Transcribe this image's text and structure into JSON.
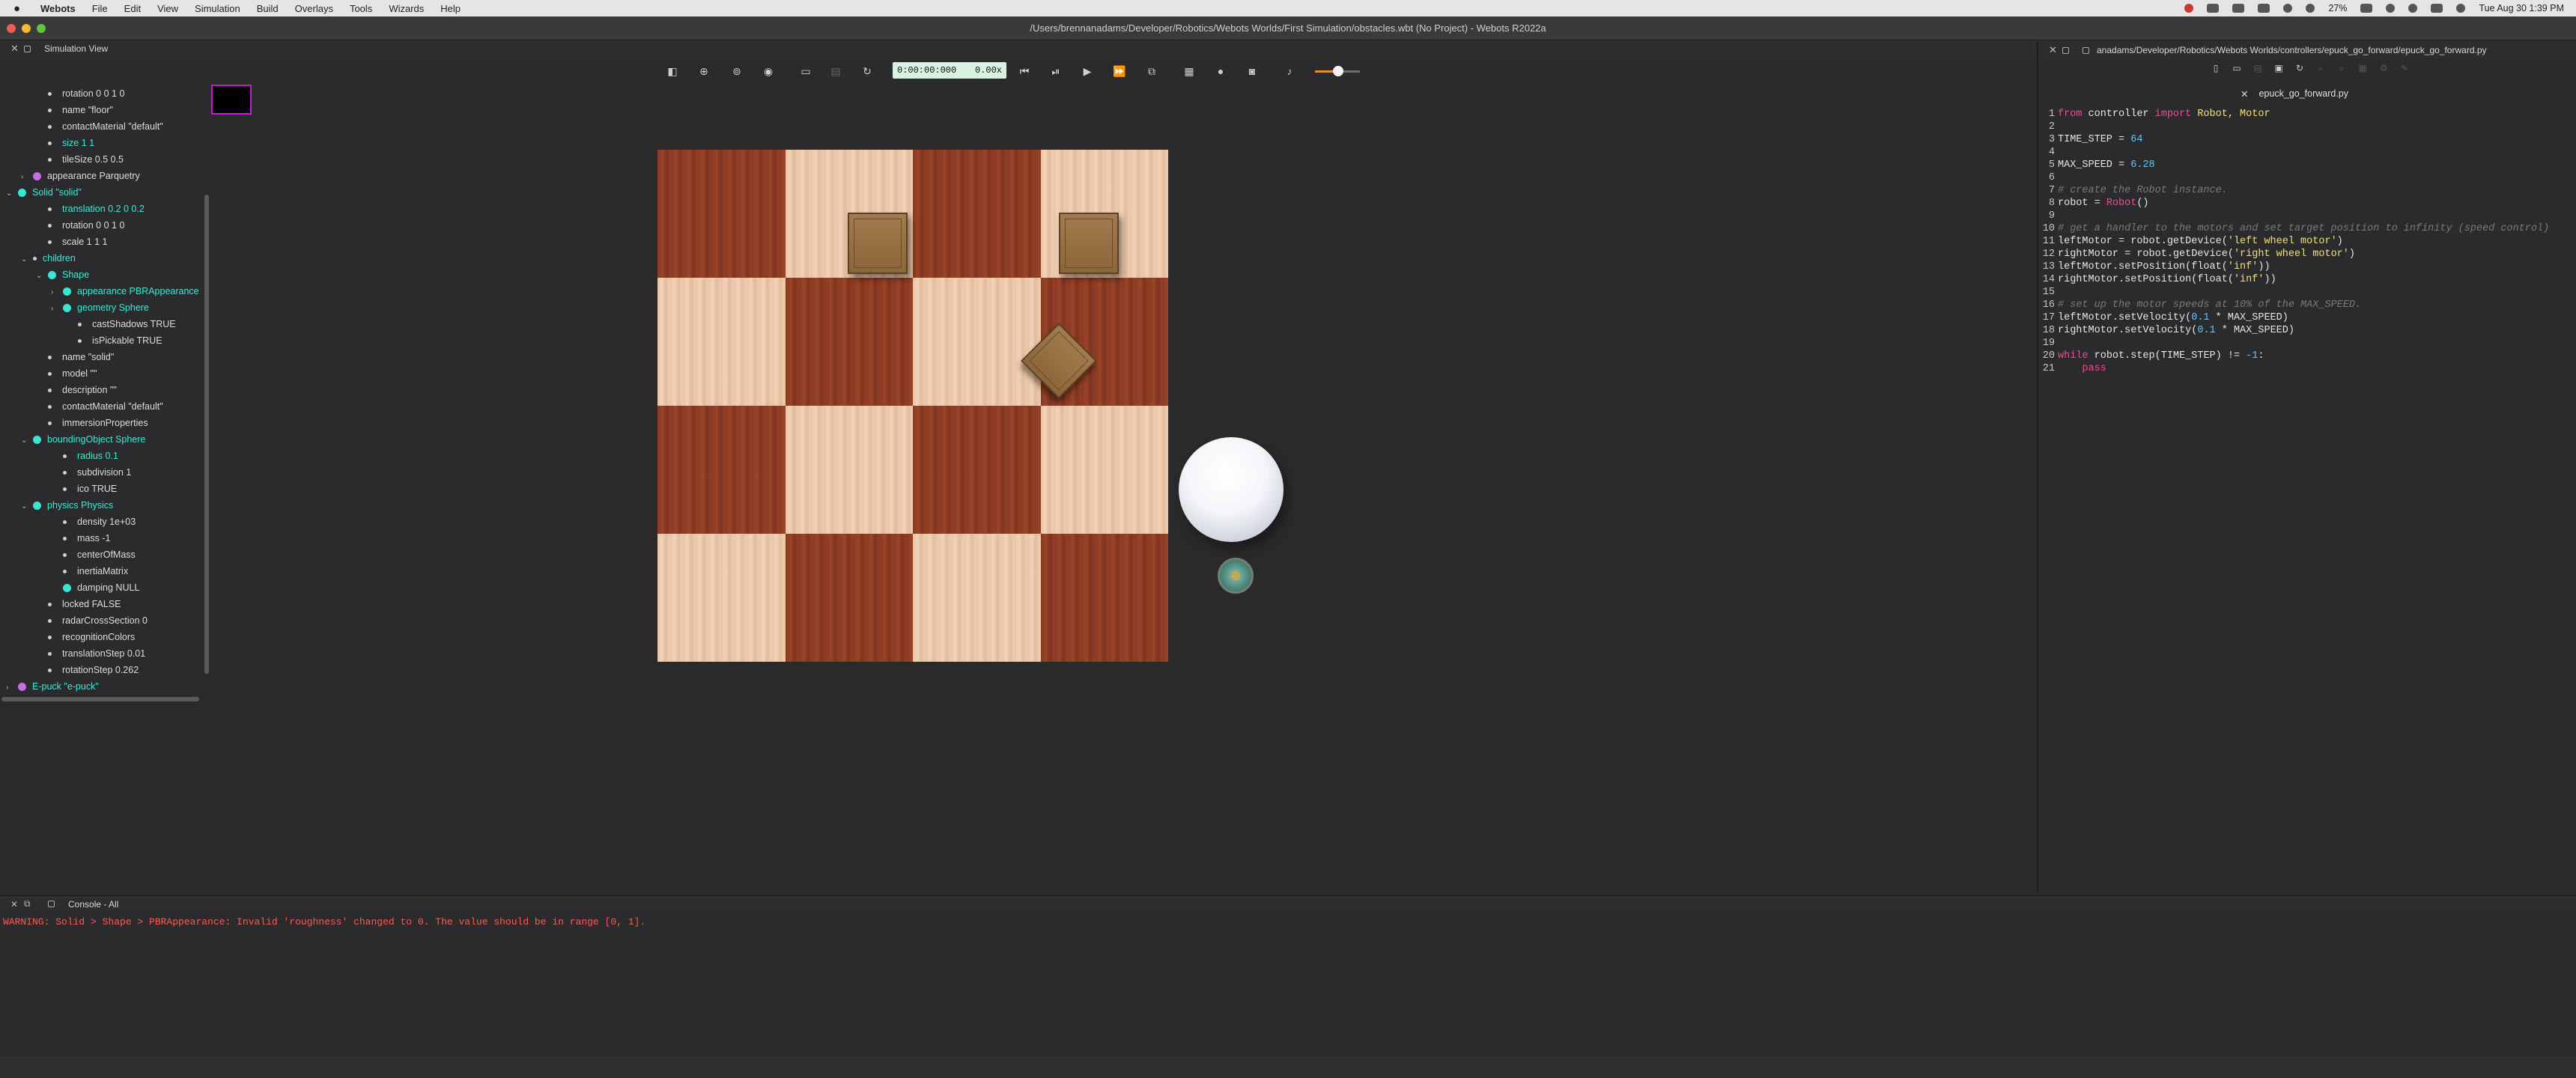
{
  "menubar": {
    "app": "Webots",
    "items": [
      "File",
      "Edit",
      "View",
      "Simulation",
      "Build",
      "Overlays",
      "Tools",
      "Wizards",
      "Help"
    ],
    "battery": "27%",
    "datetime": "Tue Aug 30  1:39 PM"
  },
  "window": {
    "title": "/Users/brennanadams/Developer/Robotics/Webots Worlds/First Simulation/obstacles.wbt (No Project) - Webots R2022a"
  },
  "simulation_view": {
    "title": "Simulation View",
    "time": "0:00:00:000",
    "speed": "0.00x",
    "sound_volume": 0.5
  },
  "scene_tree": [
    {
      "label": "rotation 0 0 1 0",
      "kind": "field",
      "indent": 3
    },
    {
      "label": "name \"floor\"",
      "kind": "field",
      "indent": 3
    },
    {
      "label": "contactMaterial \"default\"",
      "kind": "field",
      "indent": 3
    },
    {
      "label": "size 1 1",
      "kind": "field",
      "indent": 3,
      "highlight": true
    },
    {
      "label": "tileSize 0.5 0.5",
      "kind": "field",
      "indent": 3
    },
    {
      "label": "appearance Parquetry",
      "kind": "node",
      "indent": 2,
      "color": "purple",
      "arrow": "›"
    },
    {
      "label": "Solid \"solid\"",
      "kind": "node",
      "indent": 1,
      "color": "cyan",
      "arrow": "⌄",
      "highlight": true
    },
    {
      "label": "translation 0.2 0 0.2",
      "kind": "field",
      "indent": 3,
      "highlight": true
    },
    {
      "label": "rotation 0 0 1 0",
      "kind": "field",
      "indent": 3
    },
    {
      "label": "scale 1 1 1",
      "kind": "field",
      "indent": 3
    },
    {
      "label": "children",
      "kind": "group",
      "indent": 2,
      "arrow": "⌄",
      "highlight": true
    },
    {
      "label": "Shape",
      "kind": "node",
      "indent": 3,
      "color": "cyan",
      "arrow": "⌄",
      "highlight": true
    },
    {
      "label": "appearance PBRAppearance",
      "kind": "node",
      "indent": 4,
      "color": "cyan",
      "arrow": "›",
      "highlight": true
    },
    {
      "label": "geometry Sphere",
      "kind": "node",
      "indent": 4,
      "color": "cyan",
      "arrow": "›",
      "highlight": true
    },
    {
      "label": "castShadows TRUE",
      "kind": "field",
      "indent": 5
    },
    {
      "label": "isPickable TRUE",
      "kind": "field",
      "indent": 5
    },
    {
      "label": "name \"solid\"",
      "kind": "field",
      "indent": 3
    },
    {
      "label": "model \"\"",
      "kind": "field",
      "indent": 3
    },
    {
      "label": "description \"\"",
      "kind": "field",
      "indent": 3
    },
    {
      "label": "contactMaterial \"default\"",
      "kind": "field",
      "indent": 3
    },
    {
      "label": "immersionProperties",
      "kind": "field",
      "indent": 3
    },
    {
      "label": "boundingObject Sphere",
      "kind": "node",
      "indent": 2,
      "color": "cyan",
      "arrow": "⌄",
      "highlight": true
    },
    {
      "label": "radius 0.1",
      "kind": "field",
      "indent": 4,
      "highlight": true
    },
    {
      "label": "subdivision 1",
      "kind": "field",
      "indent": 4
    },
    {
      "label": "ico TRUE",
      "kind": "field",
      "indent": 4
    },
    {
      "label": "physics Physics",
      "kind": "node",
      "indent": 2,
      "color": "cyan",
      "arrow": "⌄",
      "highlight": true
    },
    {
      "label": "density 1e+03",
      "kind": "field",
      "indent": 4
    },
    {
      "label": "mass -1",
      "kind": "field",
      "indent": 4
    },
    {
      "label": "centerOfMass",
      "kind": "field",
      "indent": 4
    },
    {
      "label": "inertiaMatrix",
      "kind": "field",
      "indent": 4
    },
    {
      "label": "damping NULL",
      "kind": "node",
      "indent": 4,
      "color": "cyan"
    },
    {
      "label": "locked FALSE",
      "kind": "field",
      "indent": 3
    },
    {
      "label": "radarCrossSection 0",
      "kind": "field",
      "indent": 3
    },
    {
      "label": "recognitionColors",
      "kind": "field",
      "indent": 3
    },
    {
      "label": "translationStep 0.01",
      "kind": "field",
      "indent": 3
    },
    {
      "label": "rotationStep 0.262",
      "kind": "field",
      "indent": 3
    },
    {
      "label": "E-puck \"e-puck\"",
      "kind": "node",
      "indent": 1,
      "color": "purple",
      "arrow": "›",
      "highlight": true
    }
  ],
  "editor": {
    "path": "anadams/Developer/Robotics/Webots Worlds/controllers/epuck_go_forward/epuck_go_forward.py",
    "tab": "epuck_go_forward.py",
    "lines": [
      [
        {
          "t": "kw",
          "v": "from"
        },
        {
          "t": "txt",
          "v": " controller "
        },
        {
          "t": "kw",
          "v": "import"
        },
        {
          "t": "str",
          "v": " Robot, Motor"
        }
      ],
      [],
      [
        {
          "t": "txt",
          "v": "TIME_STEP = "
        },
        {
          "t": "num",
          "v": "64"
        }
      ],
      [],
      [
        {
          "t": "txt",
          "v": "MAX_SPEED = "
        },
        {
          "t": "num",
          "v": "6.28"
        }
      ],
      [],
      [
        {
          "t": "com",
          "v": "# create the Robot instance."
        }
      ],
      [
        {
          "t": "txt",
          "v": "robot = "
        },
        {
          "t": "kw",
          "v": "Robot"
        },
        {
          "t": "txt",
          "v": "()"
        }
      ],
      [],
      [
        {
          "t": "com",
          "v": "# get a handler to the motors and set target position to infinity (speed control)"
        }
      ],
      [
        {
          "t": "txt",
          "v": "leftMotor = robot.getDevice("
        },
        {
          "t": "str",
          "v": "'left wheel motor'"
        },
        {
          "t": "txt",
          "v": ")"
        }
      ],
      [
        {
          "t": "txt",
          "v": "rightMotor = robot.getDevice("
        },
        {
          "t": "str",
          "v": "'right wheel motor'"
        },
        {
          "t": "txt",
          "v": ")"
        }
      ],
      [
        {
          "t": "txt",
          "v": "leftMotor.setPosition(float("
        },
        {
          "t": "str",
          "v": "'inf'"
        },
        {
          "t": "txt",
          "v": "))"
        }
      ],
      [
        {
          "t": "txt",
          "v": "rightMotor.setPosition(float("
        },
        {
          "t": "str",
          "v": "'inf'"
        },
        {
          "t": "txt",
          "v": "))"
        }
      ],
      [],
      [
        {
          "t": "com",
          "v": "# set up the motor speeds at 10% of the MAX_SPEED."
        }
      ],
      [
        {
          "t": "txt",
          "v": "leftMotor.setVelocity("
        },
        {
          "t": "num",
          "v": "0.1"
        },
        {
          "t": "txt",
          "v": " * MAX_SPEED)"
        }
      ],
      [
        {
          "t": "txt",
          "v": "rightMotor.setVelocity("
        },
        {
          "t": "num",
          "v": "0.1"
        },
        {
          "t": "txt",
          "v": " * MAX_SPEED)"
        }
      ],
      [],
      [
        {
          "t": "kw",
          "v": "while"
        },
        {
          "t": "txt",
          "v": " robot.step(TIME_STEP) != "
        },
        {
          "t": "num",
          "v": "-1"
        },
        {
          "t": "txt",
          "v": ":"
        }
      ],
      [
        {
          "t": "txt",
          "v": "    "
        },
        {
          "t": "kw",
          "v": "pass"
        }
      ]
    ]
  },
  "console": {
    "title": "Console - All",
    "messages": [
      "WARNING: Solid > Shape > PBRAppearance: Invalid 'roughness' changed to 0. The value should be in range [0, 1]."
    ]
  }
}
